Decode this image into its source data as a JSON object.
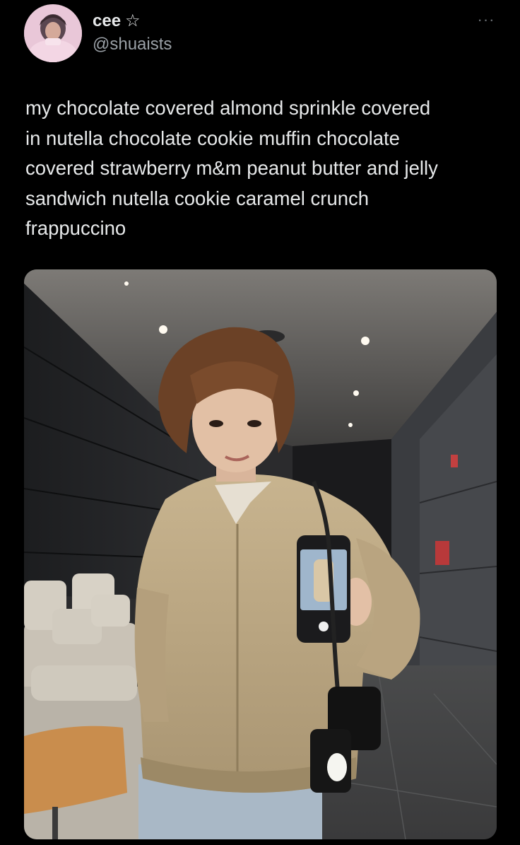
{
  "author": {
    "display_name": "cee",
    "badge_icon": "star-outline-icon",
    "badge_glyph": "☆",
    "handle": "@shuaists"
  },
  "post": {
    "text": "my chocolate covered almond sprinkle covered\nin nutella chocolate cookie muffin chocolate\ncovered strawberry m&m peanut butter and jelly\nsandwich nutella cookie caramel crunch\nfrappuccino",
    "more_glyph": "···"
  },
  "colors": {
    "background": "#000000",
    "text_primary": "#e7e9ea",
    "text_secondary": "#9aa0a6"
  }
}
